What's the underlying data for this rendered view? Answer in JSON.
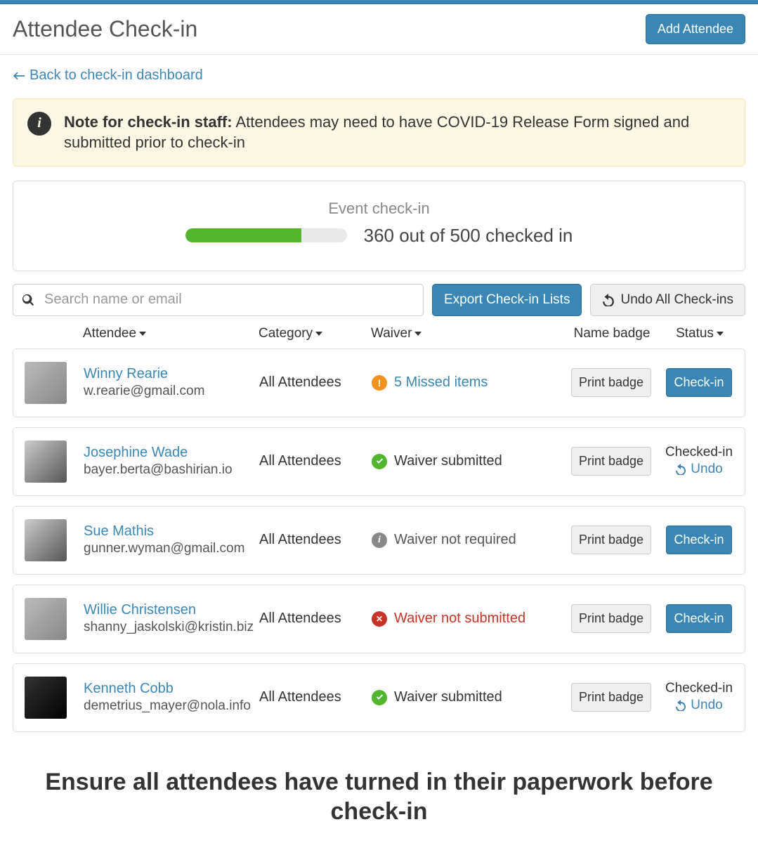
{
  "header": {
    "title": "Attendee Check-in",
    "add_button": "Add Attendee"
  },
  "back_link": "Back to check-in dashboard",
  "note": {
    "prefix": "Note for check-in staff:",
    "body": "Attendees may need to have COVID-19 Release Form signed and submitted prior to check-in"
  },
  "progress": {
    "title": "Event check-in",
    "text": "360 out of 500 checked in",
    "checked": 360,
    "total": 500,
    "percent": 72
  },
  "search": {
    "placeholder": "Search name or email"
  },
  "actions": {
    "export": "Export Check-in Lists",
    "undo_all": "Undo All Check-ins"
  },
  "columns": {
    "attendee": "Attendee",
    "category": "Category",
    "waiver": "Waiver",
    "badge": "Name badge",
    "status": "Status"
  },
  "labels": {
    "print_badge": "Print badge",
    "check_in": "Check-in",
    "checked_in": "Checked-in",
    "undo": "Undo"
  },
  "attendees": [
    {
      "name": "Winny Rearie",
      "email": "w.rearie@gmail.com",
      "category": "All Attendees",
      "waiver_text": "5 Missed items",
      "waiver_state": "missed",
      "status": "pending",
      "avatar": "color"
    },
    {
      "name": "Josephine Wade",
      "email": "bayer.berta@bashirian.io",
      "category": "All Attendees",
      "waiver_text": "Waiver submitted",
      "waiver_state": "submitted",
      "status": "checked",
      "avatar": "bw"
    },
    {
      "name": "Sue Mathis",
      "email": "gunner.wyman@gmail.com",
      "category": "All Attendees",
      "waiver_text": "Waiver not required",
      "waiver_state": "notrequired",
      "status": "pending",
      "avatar": "bw"
    },
    {
      "name": "Willie Christensen",
      "email": "shanny_jaskolski@kristin.biz",
      "category": "All Attendees",
      "waiver_text": "Waiver not submitted",
      "waiver_state": "notsubmitted",
      "status": "pending",
      "avatar": "color"
    },
    {
      "name": "Kenneth Cobb",
      "email": "demetrius_mayer@nola.info",
      "category": "All Attendees",
      "waiver_text": "Waiver submitted",
      "waiver_state": "submitted",
      "status": "checked",
      "avatar": "dark"
    }
  ],
  "footer": "Ensure all attendees have turned in their paperwork before check-in"
}
